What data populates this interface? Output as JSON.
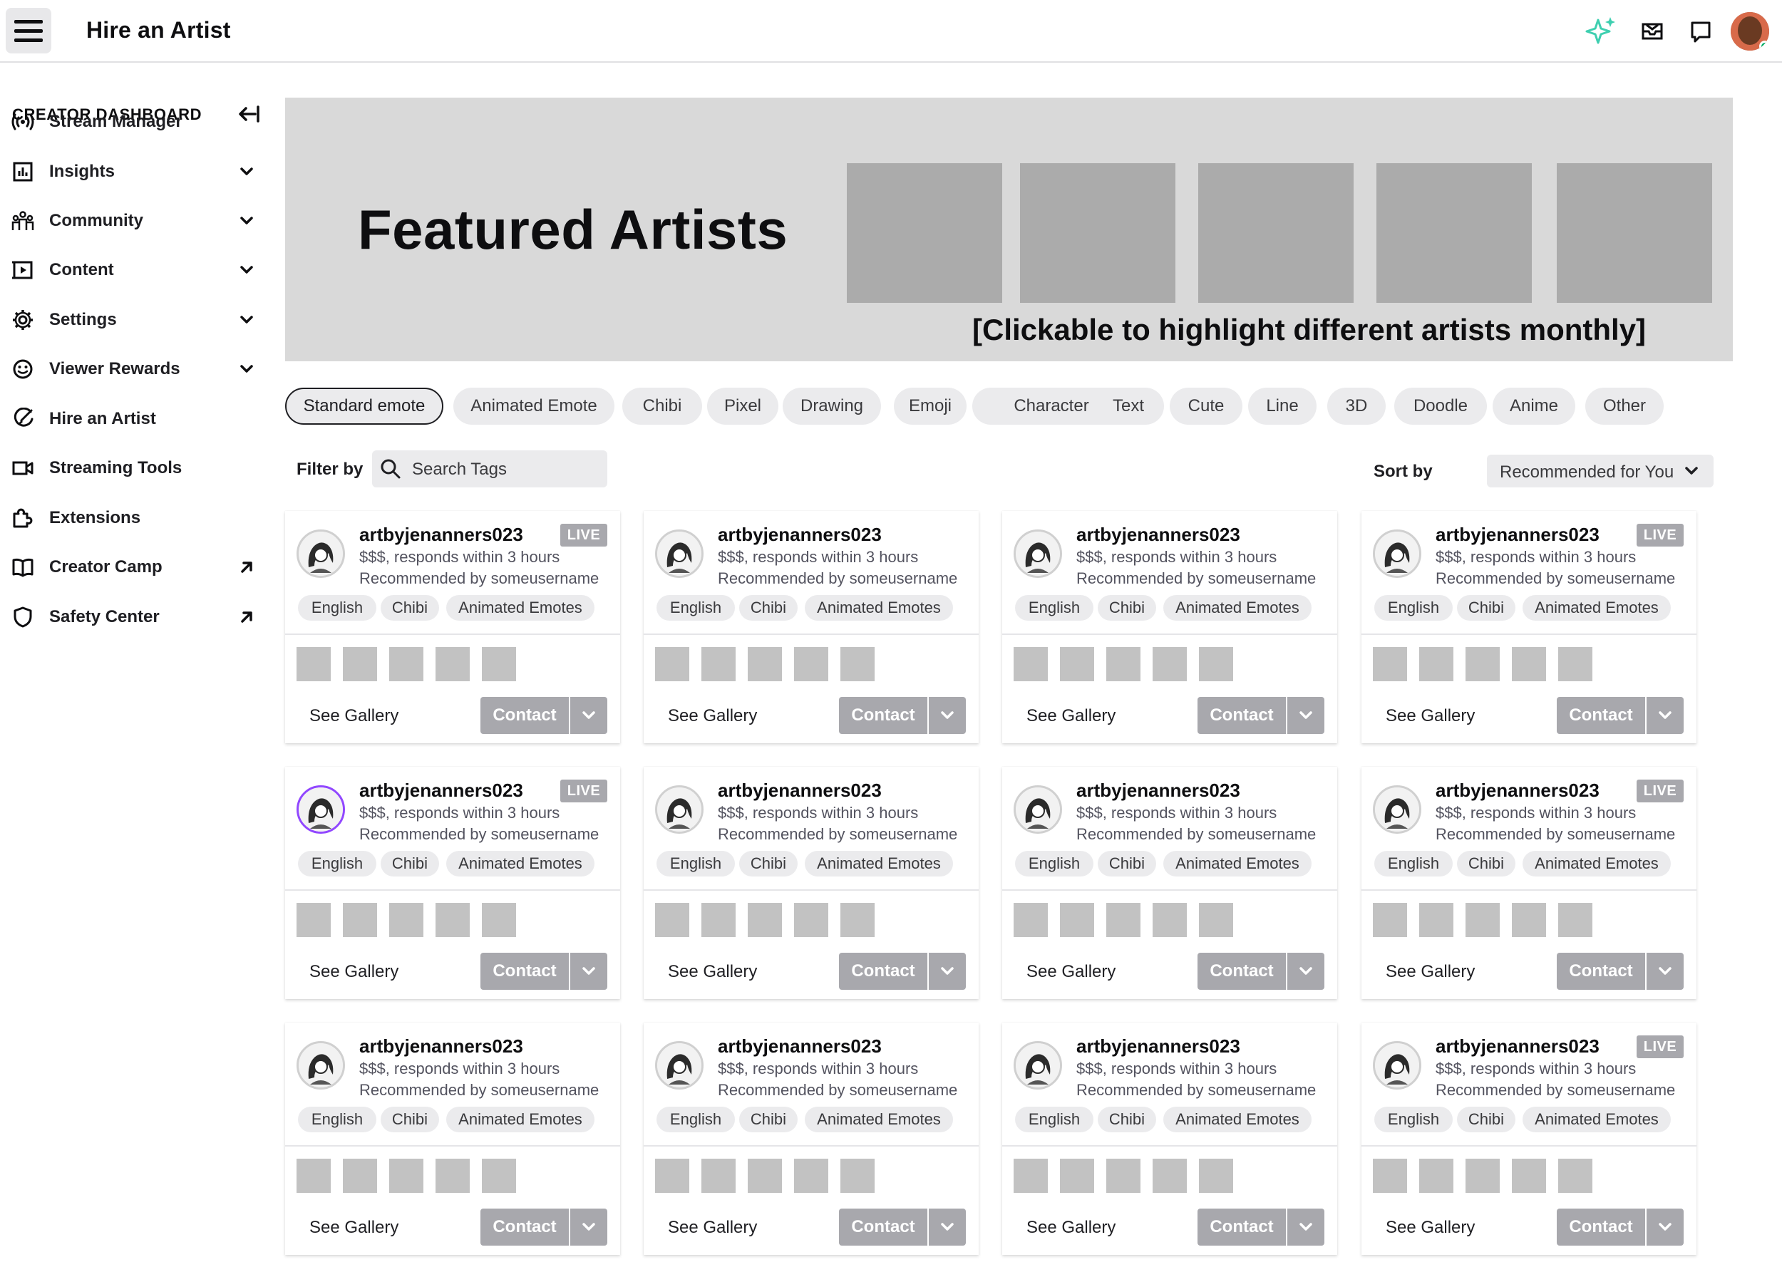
{
  "header": {
    "title": "Hire an Artist"
  },
  "sidebar": {
    "title": "CREATOR DASHBOARD",
    "items": [
      {
        "label": "Stream Manager",
        "icon": "broadcast-icon",
        "suffix": "none"
      },
      {
        "label": "Insights",
        "icon": "chart-icon",
        "suffix": "chevron"
      },
      {
        "label": "Community",
        "icon": "people-icon",
        "suffix": "chevron"
      },
      {
        "label": "Content",
        "icon": "video-icon",
        "suffix": "chevron"
      },
      {
        "label": "Settings",
        "icon": "gear-icon",
        "suffix": "chevron"
      },
      {
        "label": "Viewer Rewards",
        "icon": "smile-icon",
        "suffix": "chevron"
      },
      {
        "label": "Hire an Artist",
        "icon": "brush-icon",
        "suffix": "none"
      },
      {
        "label": "Streaming Tools",
        "icon": "camera-icon",
        "suffix": "none"
      },
      {
        "label": "Extensions",
        "icon": "puzzle-icon",
        "suffix": "none"
      },
      {
        "label": "Creator Camp",
        "icon": "book-icon",
        "suffix": "external"
      },
      {
        "label": "Safety Center",
        "icon": "shield-icon",
        "suffix": "external"
      }
    ]
  },
  "hero": {
    "title": "Featured Artists",
    "caption": "[Clickable to highlight different artists monthly]"
  },
  "chips": [
    "Standard emote",
    "Animated Emote",
    "Chibi",
    "Pixel",
    "Drawing",
    "Emoji",
    "Character",
    "Text",
    "Cute",
    "Line",
    "3D",
    "Doodle",
    "Anime",
    "Other"
  ],
  "filter": {
    "label": "Filter by",
    "placeholder": "Search Tags"
  },
  "sort": {
    "label": "Sort by",
    "value": "Recommended for You"
  },
  "cards": [
    {
      "name": "artbyjenanners023",
      "line1": "$$$, responds within 3 hours",
      "line2": "Recommended by someusername",
      "live": "LIVE",
      "tags": [
        "English",
        "Chibi",
        "Animated Emotes"
      ],
      "gallery": "See Gallery",
      "contact": "Contact"
    },
    {
      "name": "artbyjenanners023",
      "line1": "$$$, responds within 3 hours",
      "line2": "Recommended by someusername",
      "live": "",
      "tags": [
        "English",
        "Chibi",
        "Animated Emotes"
      ],
      "gallery": "See Gallery",
      "contact": "Contact"
    },
    {
      "name": "artbyjenanners023",
      "line1": "$$$, responds within 3 hours",
      "line2": "Recommended by someusername",
      "live": "",
      "tags": [
        "English",
        "Chibi",
        "Animated Emotes"
      ],
      "gallery": "See Gallery",
      "contact": "Contact"
    },
    {
      "name": "artbyjenanners023",
      "line1": "$$$, responds within 3 hours",
      "line2": "Recommended by someusername",
      "live": "LIVE",
      "tags": [
        "English",
        "Chibi",
        "Animated Emotes"
      ],
      "gallery": "See Gallery",
      "contact": "Contact"
    },
    {
      "name": "artbyjenanners023",
      "line1": "$$$, responds within 3 hours",
      "line2": "Recommended by someusername",
      "live": "LIVE",
      "tags": [
        "English",
        "Chibi",
        "Animated Emotes"
      ],
      "gallery": "See Gallery",
      "contact": "Contact",
      "highlighted": true
    },
    {
      "name": "artbyjenanners023",
      "line1": "$$$, responds within 3 hours",
      "line2": "Recommended by someusername",
      "live": "",
      "tags": [
        "English",
        "Chibi",
        "Animated Emotes"
      ],
      "gallery": "See Gallery",
      "contact": "Contact"
    },
    {
      "name": "artbyjenanners023",
      "line1": "$$$, responds within 3 hours",
      "line2": "Recommended by someusername",
      "live": "",
      "tags": [
        "English",
        "Chibi",
        "Animated Emotes"
      ],
      "gallery": "See Gallery",
      "contact": "Contact"
    },
    {
      "name": "artbyjenanners023",
      "line1": "$$$, responds within 3 hours",
      "line2": "Recommended by someusername",
      "live": "LIVE",
      "tags": [
        "English",
        "Chibi",
        "Animated Emotes"
      ],
      "gallery": "See Gallery",
      "contact": "Contact"
    },
    {
      "name": "artbyjenanners023",
      "line1": "$$$, responds within 3 hours",
      "line2": "Recommended by someusername",
      "live": "",
      "tags": [
        "English",
        "Chibi",
        "Animated Emotes"
      ],
      "gallery": "See Gallery",
      "contact": "Contact"
    },
    {
      "name": "artbyjenanners023",
      "line1": "$$$, responds within 3 hours",
      "line2": "Recommended by someusername",
      "live": "",
      "tags": [
        "English",
        "Chibi",
        "Animated Emotes"
      ],
      "gallery": "See Gallery",
      "contact": "Contact"
    },
    {
      "name": "artbyjenanners023",
      "line1": "$$$, responds within 3 hours",
      "line2": "Recommended by someusername",
      "live": "",
      "tags": [
        "English",
        "Chibi",
        "Animated Emotes"
      ],
      "gallery": "See Gallery",
      "contact": "Contact"
    },
    {
      "name": "artbyjenanners023",
      "line1": "$$$, responds within 3 hours",
      "line2": "Recommended by someusername",
      "live": "LIVE",
      "tags": [
        "English",
        "Chibi",
        "Animated Emotes"
      ],
      "gallery": "See Gallery",
      "contact": "Contact"
    }
  ],
  "colors": {
    "accent": "#9147ff",
    "button_gray": "#a8a8ad",
    "chip_bg": "#ebebed",
    "hero_bg": "#d9d9d9",
    "ai_sparkle": "#3ecfb0"
  }
}
